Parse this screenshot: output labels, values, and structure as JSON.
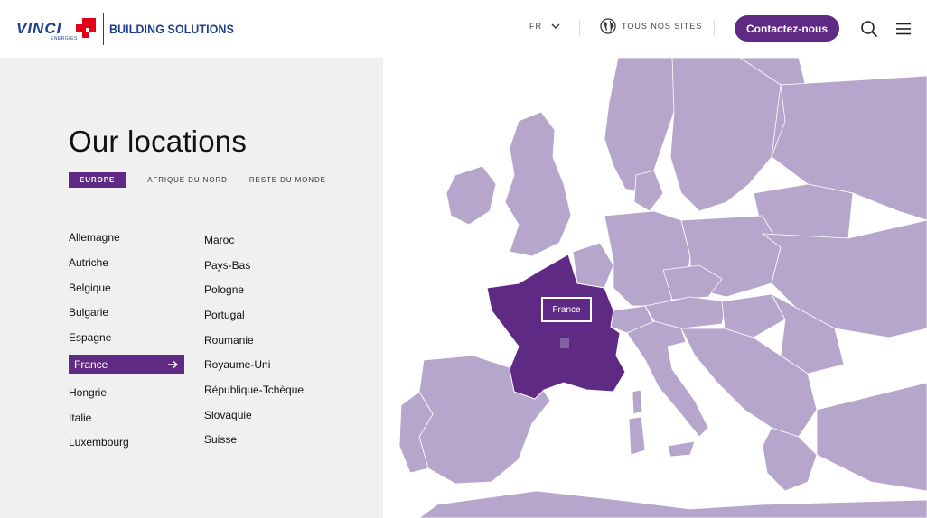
{
  "header": {
    "logo_vinci": "VINCI",
    "logo_energies": "ENERGIES",
    "logo_text": "BUILDING SOLUTIONS",
    "language": "FR",
    "sites_label": "TOUS NOS SITES",
    "contact_label": "Contactez-nous"
  },
  "title": "Our locations",
  "tabs": [
    {
      "label": "EUROPE",
      "active": true
    },
    {
      "label": "AFRIQUE DU NORD",
      "active": false
    },
    {
      "label": "RESTE DU MONDE",
      "active": false
    }
  ],
  "countries_col1": [
    "Allemagne",
    "Autriche",
    "Belgique",
    "Bulgarie",
    "Espagne",
    "France",
    "Hongrie",
    "Italie",
    "Luxembourg"
  ],
  "countries_col2": [
    "Maroc",
    "Pays-Bas",
    "Pologne",
    "Portugal",
    "Roumanie",
    "Royaume-Uni",
    "République-Tchèque",
    "Slovaquie",
    "Suisse"
  ],
  "selected_country": "France",
  "map": {
    "highlight_label": "France",
    "land_color": "#b7a6cc",
    "highlight_color": "#5e2a84"
  },
  "colors": {
    "brand_purple": "#5e2a84",
    "brand_blue": "#1d3d8f",
    "brand_red": "#e2001a",
    "panel_bg": "#f0f0f0"
  }
}
